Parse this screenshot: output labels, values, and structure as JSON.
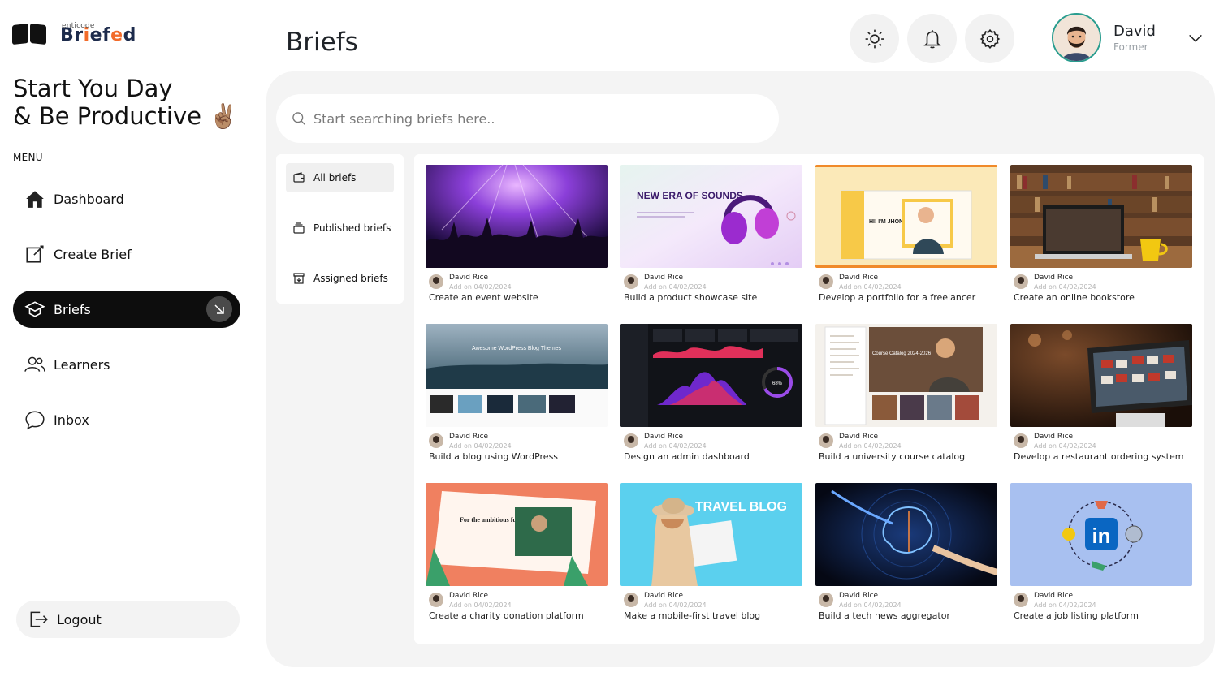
{
  "app": {
    "logo_sub": "enticode",
    "logo_prefix": "Br",
    "logo_e1": "i",
    "logo_mid": "ef",
    "logo_e2": "e",
    "logo_end": "d"
  },
  "sidebar": {
    "greeting_line1": "Start You Day",
    "greeting_line2": "& Be Productive ✌🏽",
    "menu_label": "MENU",
    "items": [
      {
        "label": "Dashboard",
        "icon": "home-icon"
      },
      {
        "label": "Create Brief",
        "icon": "edit-icon"
      },
      {
        "label": "Briefs",
        "icon": "graduation-cap-icon",
        "active": true
      },
      {
        "label": "Learners",
        "icon": "users-icon"
      },
      {
        "label": "Inbox",
        "icon": "chat-icon"
      }
    ],
    "logout_label": "Logout"
  },
  "header": {
    "title": "Briefs",
    "buttons": [
      "sun-icon",
      "bell-icon",
      "gear-icon"
    ],
    "user": {
      "name": "David",
      "role": "Former"
    }
  },
  "search": {
    "placeholder": "Start searching briefs here.."
  },
  "filters": [
    {
      "label": "All briefs",
      "active": true
    },
    {
      "label": "Published briefs",
      "active": false
    },
    {
      "label": "Assigned briefs",
      "active": false
    }
  ],
  "colors": {
    "accent_orange": "#f26b2a",
    "active_nav": "#0d0d0d",
    "panel_bg": "#f4f4f4"
  },
  "briefs": [
    {
      "author": "David Rice",
      "date": "Add on 04/02/2024",
      "title": "Create an event website",
      "thumb_text": ""
    },
    {
      "author": "David Rice",
      "date": "Add on 04/02/2024",
      "title": "Build a product showcase site",
      "thumb_text": "NEW ERA OF SOUNDS"
    },
    {
      "author": "David Rice",
      "date": "Add on 04/02/2024",
      "title": "Develop a portfolio for a freelancer",
      "thumb_text": "HI! I'M JHON"
    },
    {
      "author": "David Rice",
      "date": "Add on 04/02/2024",
      "title": "Create an online bookstore",
      "thumb_text": ""
    },
    {
      "author": "David Rice",
      "date": "Add on 04/02/2024",
      "title": "Build a blog using WordPress",
      "thumb_text": "Awesome WordPress Blog Themes"
    },
    {
      "author": "David Rice",
      "date": "Add on 04/02/2024",
      "title": "Design an admin dashboard",
      "thumb_text": "68%"
    },
    {
      "author": "David Rice",
      "date": "Add on 04/02/2024",
      "title": "Build a university course catalog",
      "thumb_text": "Course Catalog 2024-2026"
    },
    {
      "author": "David Rice",
      "date": "Add on 04/02/2024",
      "title": "Develop a restaurant ordering system",
      "thumb_text": ""
    },
    {
      "author": "David Rice",
      "date": "Add on 04/02/2024",
      "title": "Create a charity donation platform",
      "thumb_text": "For the ambitious fundraiser"
    },
    {
      "author": "David Rice",
      "date": "Add on 04/02/2024",
      "title": "Make a mobile-first travel blog",
      "thumb_text": "TRAVEL BLOG"
    },
    {
      "author": "David Rice",
      "date": "Add on 04/02/2024",
      "title": "Build a tech news aggregator",
      "thumb_text": ""
    },
    {
      "author": "David Rice",
      "date": "Add on 04/02/2024",
      "title": "Create a job listing platform",
      "thumb_text": "in"
    }
  ]
}
